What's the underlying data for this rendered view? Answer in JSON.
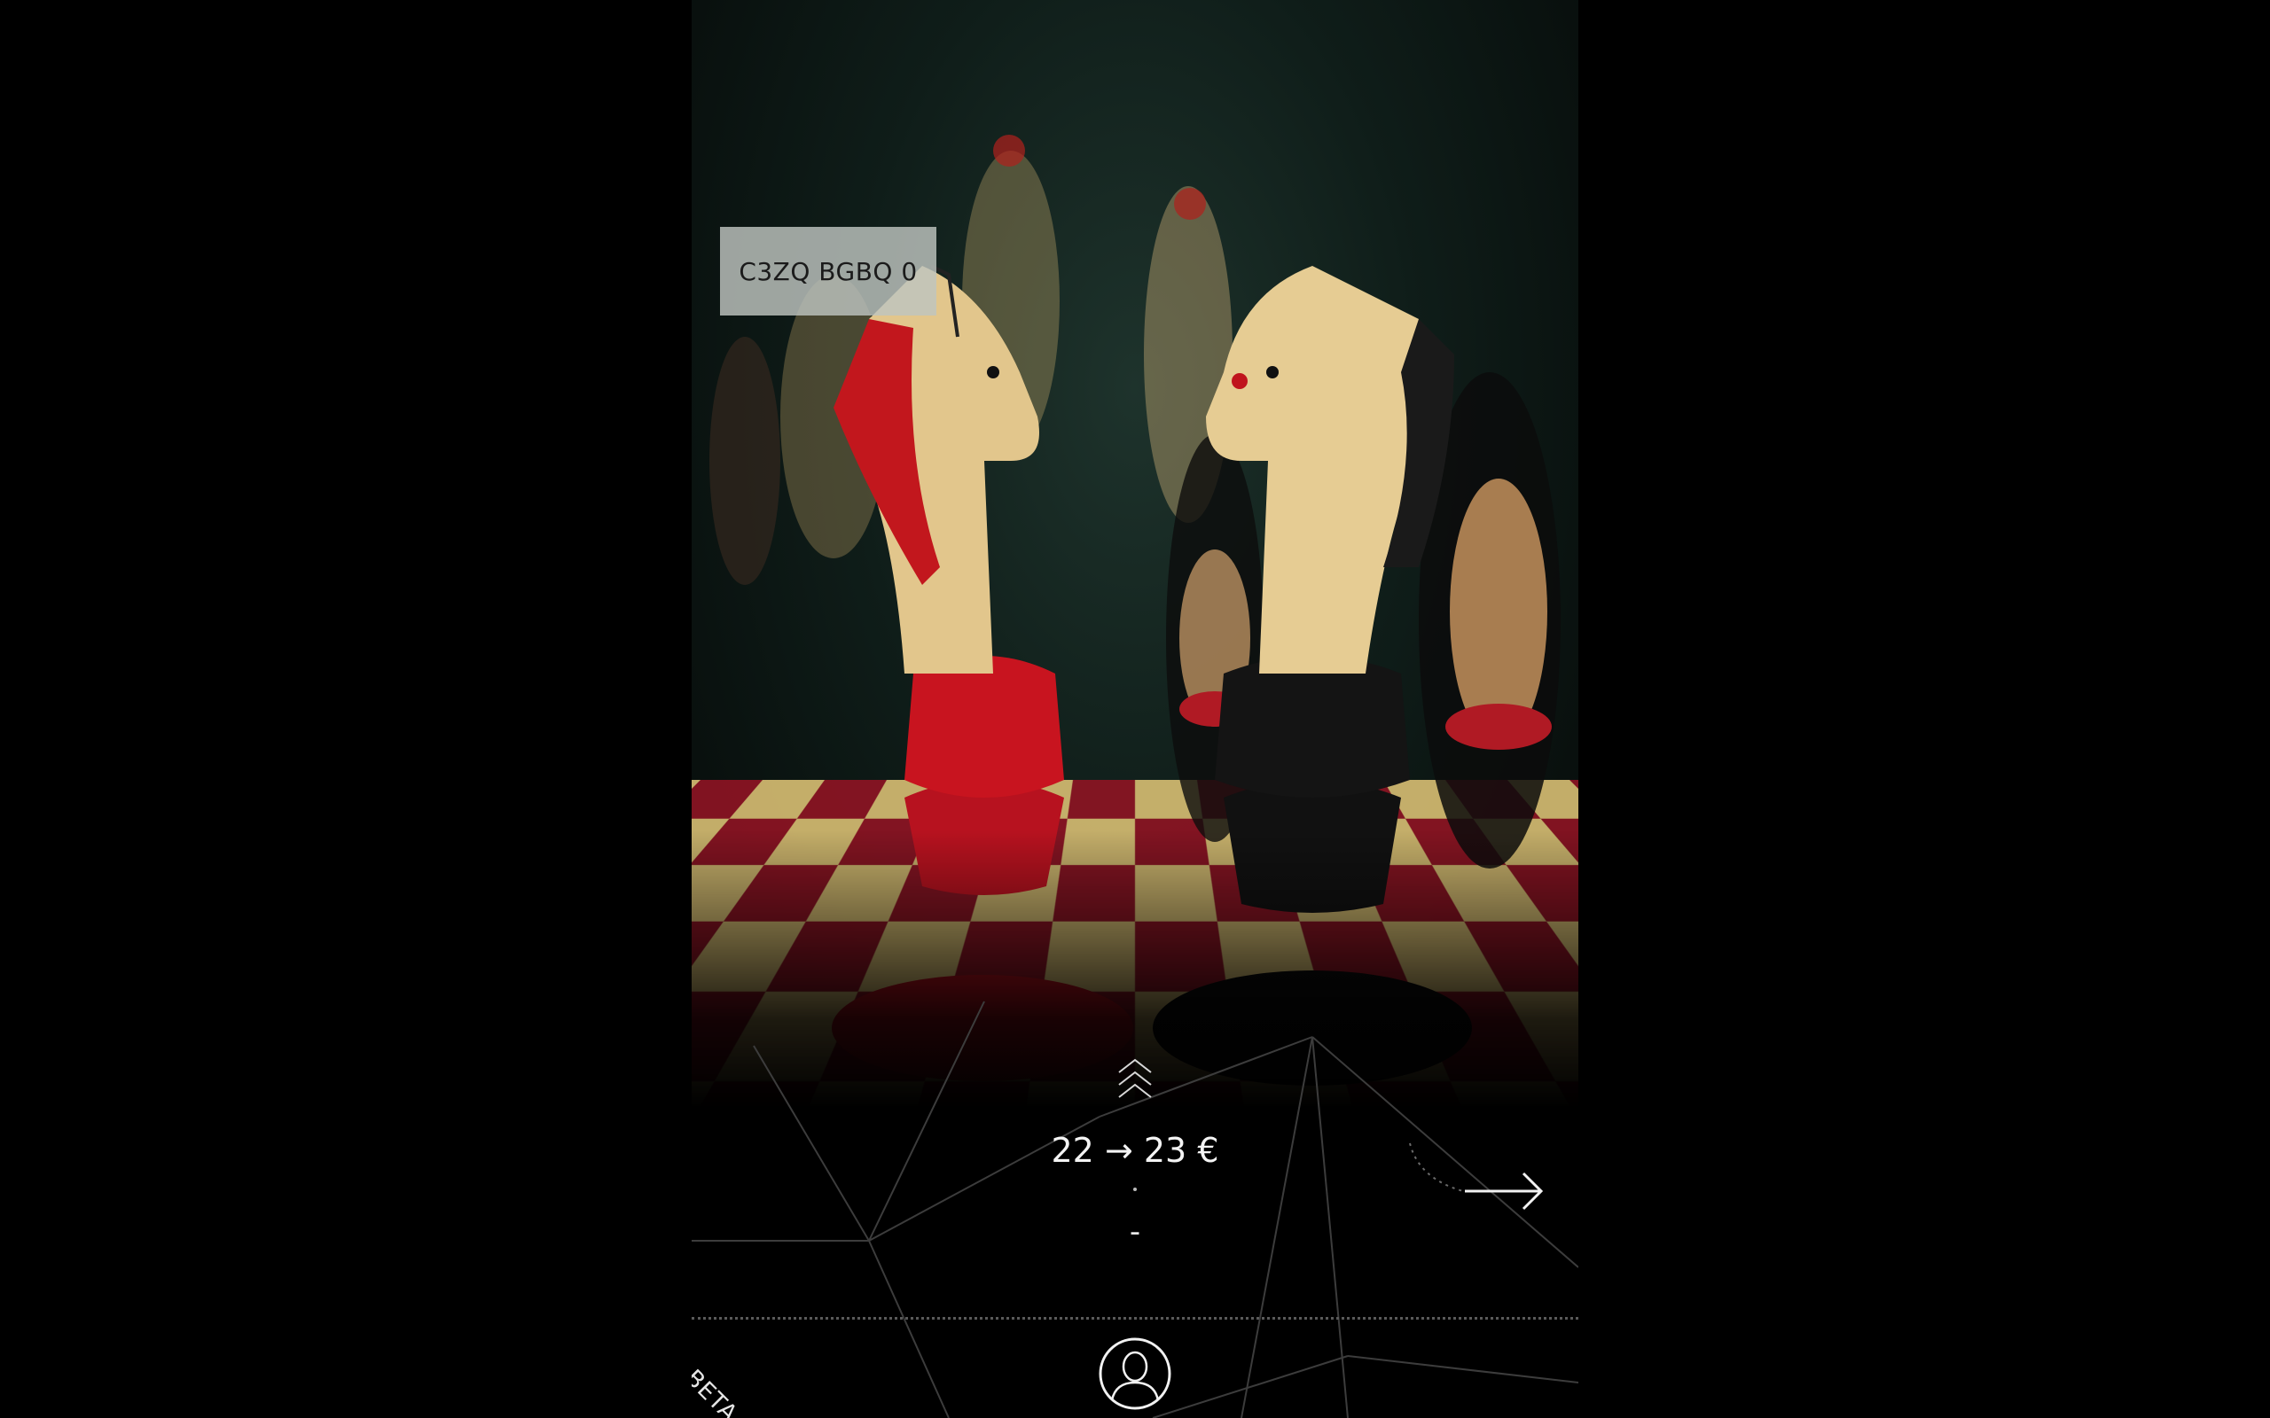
{
  "photo": {
    "tag_text": "C3ZQ BGBQ 0"
  },
  "price": {
    "from": "22",
    "arrow": "→",
    "to": "23",
    "currency": "€"
  },
  "secondary_line": "-",
  "footer": {
    "beta_label": "BETA"
  },
  "icons": {
    "expand": "chevrons-up-icon",
    "next": "arrow-right-icon",
    "profile": "user-icon"
  },
  "colors": {
    "background": "#000000",
    "text": "#f4f4f4",
    "tag_background": "#bec4c0"
  }
}
